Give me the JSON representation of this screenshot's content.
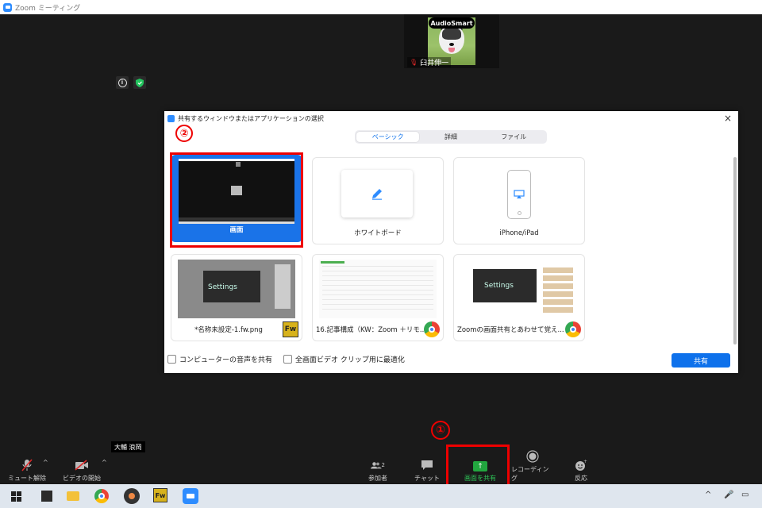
{
  "window": {
    "title": "Zoom ミーティング"
  },
  "meeting": {
    "speaker_badge": "AudioSmart",
    "participant_name": "臼井伸一",
    "hover_label": "大輔 浪岡"
  },
  "dialog": {
    "title": "共有するウィンドウまたはアプリケーションの選択",
    "close": "×",
    "tabs": [
      {
        "label": "ベーシック",
        "active": true
      },
      {
        "label": "詳細"
      },
      {
        "label": "ファイル"
      }
    ],
    "cards": {
      "screen": "画面",
      "whiteboard": "ホワイトボード",
      "iphone": "iPhone/iPad",
      "fw": "*名称未設定-1.fw.png",
      "doc": "16.記事構成（KW：Zoom ＋リモ...",
      "web": "Zoomの画面共有とあわせて覚え..."
    },
    "thumb_text": "Settings",
    "fw_icon": "Fw",
    "options": {
      "share_audio": "コンピューターの音声を共有",
      "optimize_video": "全画面ビデオ クリップ用に最適化"
    },
    "share_button": "共有",
    "marker": "②"
  },
  "toolbar": {
    "unmute": "ミュート解除",
    "start_video": "ビデオの開始",
    "participants": "参加者",
    "participants_count": "2",
    "chat": "チャット",
    "share_screen": "画面を共有",
    "recording": "レコーディング",
    "reactions": "反応",
    "marker": "①"
  },
  "taskbar": {
    "fw_label": "Fw"
  },
  "colors": {
    "accent": "#0e71eb",
    "share_green": "#22a63f",
    "highlight_red": "#e00000"
  }
}
